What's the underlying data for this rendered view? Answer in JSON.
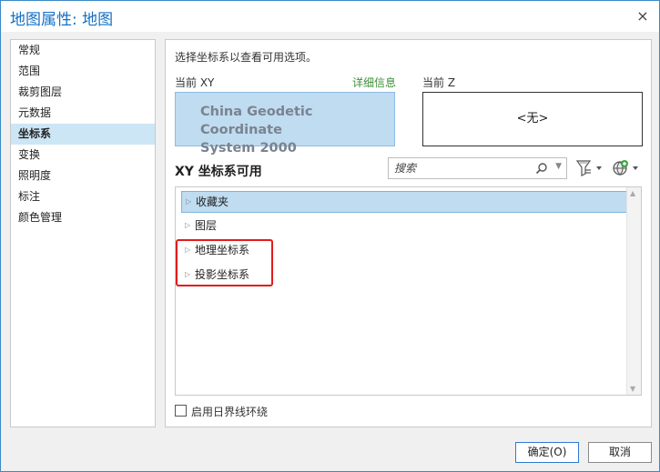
{
  "window": {
    "title": "地图属性: 地图",
    "close_glyph": "×"
  },
  "nav": {
    "items": [
      {
        "label": "常规"
      },
      {
        "label": "范围"
      },
      {
        "label": "裁剪图层"
      },
      {
        "label": "元数据"
      },
      {
        "label": "坐标系",
        "selected": true
      },
      {
        "label": "变换"
      },
      {
        "label": "照明度"
      },
      {
        "label": "标注"
      },
      {
        "label": "颜色管理"
      }
    ]
  },
  "panel": {
    "instruction": "选择坐标系以查看可用选项。",
    "current_xy_label": "当前 XY",
    "details_link": "详细信息",
    "current_z_label": "当前 Z",
    "current_xy_value_line1": "China Geodetic Coordinate",
    "current_xy_value_line2": "System 2000",
    "current_z_value": "<无>",
    "section_title": "XY 坐标系可用",
    "search_placeholder": "搜索",
    "tree": [
      {
        "label": "收藏夹",
        "selected": true
      },
      {
        "label": "图层"
      },
      {
        "label": "地理坐标系",
        "highlighted": true
      },
      {
        "label": "投影坐标系",
        "highlighted": true
      }
    ],
    "enable_dateline_label": "启用日界线环绕",
    "enable_dateline_checked": false
  },
  "buttons": {
    "ok_label": "确定(O)",
    "cancel_label": "取消"
  },
  "colors": {
    "accent": "#1570c4",
    "selection": "#cde6f6",
    "highlight_border": "#e21b1b",
    "details_link": "#3f8f3a"
  },
  "icons": {
    "search": "search-icon",
    "filter": "filter-icon",
    "globe": "globe-add-icon",
    "expander": "triangle-right-icon"
  }
}
